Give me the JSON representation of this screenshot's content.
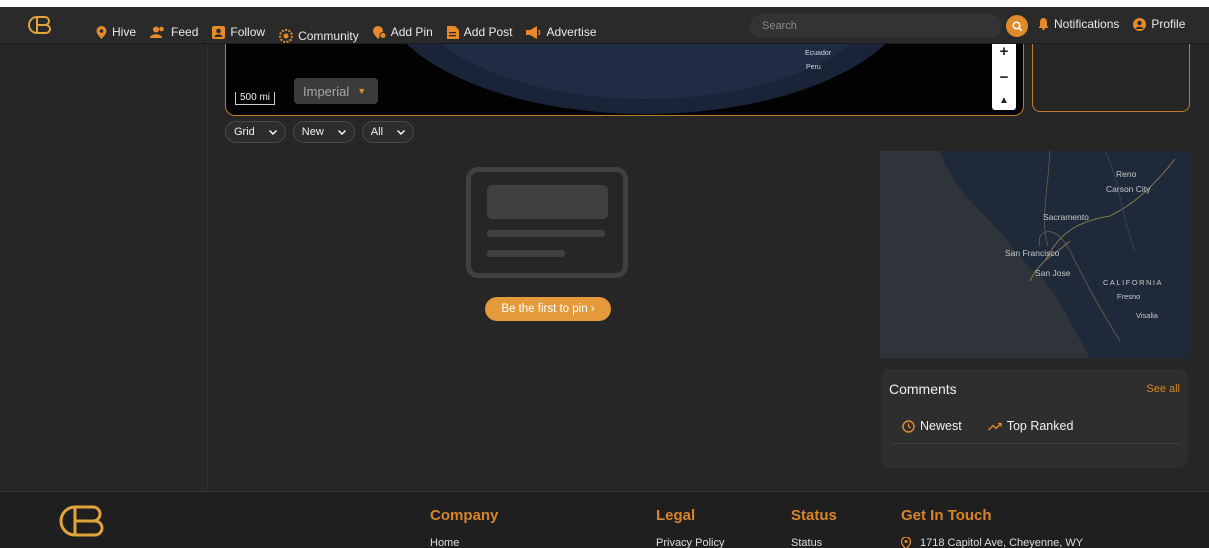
{
  "nav": {
    "items": [
      {
        "label": "Hive",
        "icon": "map-pin-icon"
      },
      {
        "label": "Feed",
        "icon": "users-icon"
      },
      {
        "label": "Follow",
        "icon": "follow-icon"
      },
      {
        "label": "Community",
        "icon": "community-icon"
      },
      {
        "label": "Add Pin",
        "icon": "add-pin-icon"
      },
      {
        "label": "Add Post",
        "icon": "add-post-icon"
      },
      {
        "label": "Advertise",
        "icon": "megaphone-icon"
      }
    ],
    "active": "Community",
    "search_placeholder": "Search",
    "notifications_label": "Notifications",
    "profile_label": "Profile"
  },
  "map": {
    "scale_label": "500 mi",
    "units_label": "Imperial",
    "labels": [
      "Ecuador",
      "Peru"
    ],
    "zoom_in": "+",
    "zoom_out": "−"
  },
  "filters": {
    "layout": "Grid",
    "sort": "New",
    "scope": "All"
  },
  "empty_state": {
    "cta_label": "Be the first to pin ›"
  },
  "side_map": {
    "cities": [
      "Reno",
      "Carson City",
      "Sacramento",
      "San Francisco",
      "San Jose",
      "CALIFORNIA",
      "Fresno",
      "Visalia"
    ]
  },
  "comments": {
    "title": "Comments",
    "see_all": "See all",
    "tabs": [
      "Newest",
      "Top Ranked"
    ]
  },
  "footer": {
    "company_heading": "Company",
    "company_link": "Home",
    "legal_heading": "Legal",
    "legal_link": "Privacy Policy",
    "status_heading": "Status",
    "status_link": "Status",
    "contact_heading": "Get In Touch",
    "address": "1718 Capitol Ave, Cheyenne, WY"
  },
  "colors": {
    "accent": "#d8852a",
    "background": "#262626",
    "cta": "#e49a3a"
  }
}
